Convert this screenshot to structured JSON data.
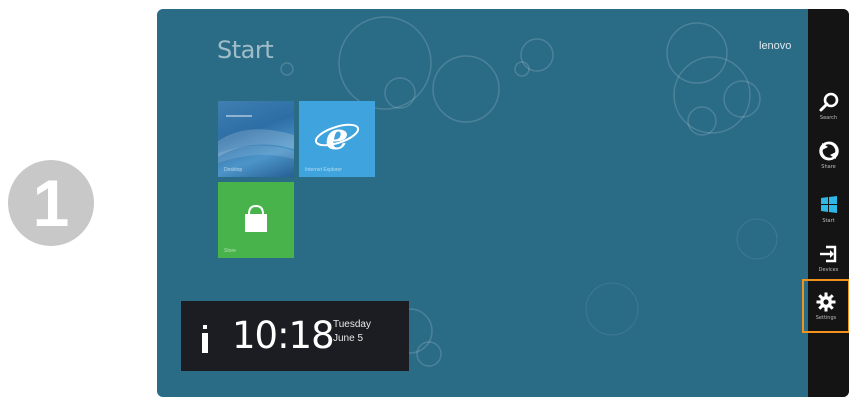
{
  "step": {
    "number": "1"
  },
  "start_screen": {
    "title": "Start",
    "brand": "lenovo",
    "tiles": [
      {
        "name": "desktop",
        "label": "Desktop"
      },
      {
        "name": "internet-explorer",
        "label": "Internet Explorer"
      },
      {
        "name": "store",
        "label": "Store"
      }
    ]
  },
  "clock": {
    "time": "10:18",
    "day": "Tuesday",
    "date": "June 5"
  },
  "charms": [
    {
      "label": "Search",
      "icon": "search-icon"
    },
    {
      "label": "Share",
      "icon": "share-icon"
    },
    {
      "label": "Start",
      "icon": "windows-logo-icon"
    },
    {
      "label": "Devices",
      "icon": "devices-icon"
    },
    {
      "label": "Settings",
      "icon": "gear-icon"
    }
  ],
  "colors": {
    "background": "#2a6b86",
    "charm_bar": "#141414",
    "highlight": "#f2921f",
    "ie_tile": "#3fa4dd",
    "store_tile": "#48b34a",
    "windows_logo": "#2fb7e6"
  }
}
